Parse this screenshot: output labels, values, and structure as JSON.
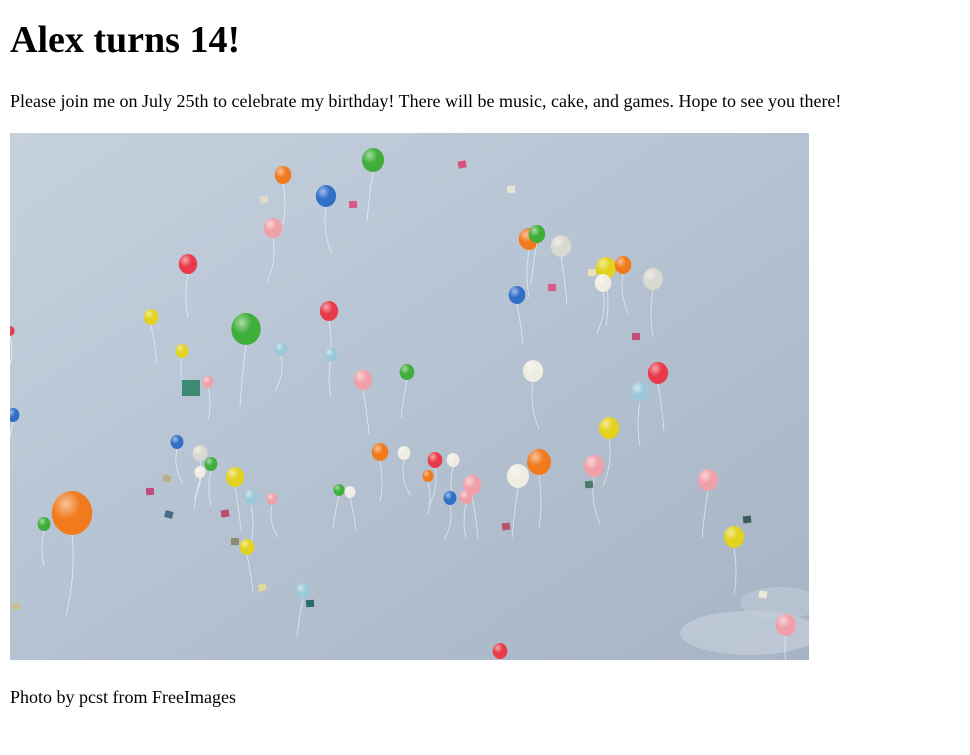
{
  "heading": "Alex turns 14!",
  "invitation": "Please join me on July 25th to celebrate my birthday! There will be music, cake, and games. Hope to see you there!",
  "photo": {
    "alt": "Colorful balloons floating in a blue-gray sky",
    "sky_top": "#c3cfdd",
    "sky_bottom": "#a9b6c6"
  },
  "credit": "Photo by pcst from FreeImages"
}
